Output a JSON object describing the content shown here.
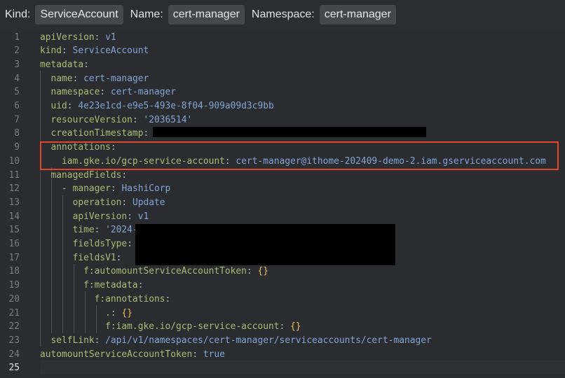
{
  "header": {
    "kind_label": "Kind:",
    "kind_value": "ServiceAccount",
    "name_label": "Name:",
    "name_value": "cert-manager",
    "namespace_label": "Namespace:",
    "namespace_value": "cert-manager"
  },
  "colors": {
    "background": "#2b2c30",
    "key": "#a9bd76",
    "value": "#82a5d8",
    "brace": "#e2c15a",
    "highlight_box": "#e0452f"
  },
  "lines": [
    {
      "n": "1",
      "parts": [
        {
          "t": "apiVersion",
          "c": "k"
        },
        {
          "t": ": ",
          "c": "p"
        },
        {
          "t": "v1",
          "c": "v"
        }
      ]
    },
    {
      "n": "2",
      "parts": [
        {
          "t": "kind",
          "c": "k"
        },
        {
          "t": ": ",
          "c": "p"
        },
        {
          "t": "ServiceAccount",
          "c": "v"
        }
      ]
    },
    {
      "n": "3",
      "parts": [
        {
          "t": "metadata",
          "c": "k"
        },
        {
          "t": ":",
          "c": "p"
        }
      ]
    },
    {
      "n": "4",
      "parts": [
        {
          "t": "  name",
          "c": "k"
        },
        {
          "t": ": ",
          "c": "p"
        },
        {
          "t": "cert-manager",
          "c": "v"
        }
      ]
    },
    {
      "n": "5",
      "parts": [
        {
          "t": "  namespace",
          "c": "k"
        },
        {
          "t": ": ",
          "c": "p"
        },
        {
          "t": "cert-manager",
          "c": "v"
        }
      ]
    },
    {
      "n": "6",
      "parts": [
        {
          "t": "  uid",
          "c": "k"
        },
        {
          "t": ": ",
          "c": "p"
        },
        {
          "t": "4e23e1cd-e9e5-493e-8f04-909a09d3c9bb",
          "c": "v"
        }
      ]
    },
    {
      "n": "7",
      "parts": [
        {
          "t": "  resourceVersion",
          "c": "k"
        },
        {
          "t": ": ",
          "c": "p"
        },
        {
          "t": "'2036514'",
          "c": "v"
        }
      ]
    },
    {
      "n": "8",
      "parts": [
        {
          "t": "  creationTimestamp",
          "c": "k"
        },
        {
          "t": ":",
          "c": "p"
        }
      ]
    },
    {
      "n": "9",
      "parts": [
        {
          "t": "  annotations",
          "c": "k"
        },
        {
          "t": ":",
          "c": "p"
        }
      ]
    },
    {
      "n": "10",
      "parts": [
        {
          "t": "    iam.gke.io/gcp-service-account",
          "c": "k"
        },
        {
          "t": ": ",
          "c": "p"
        },
        {
          "t": "cert-manager@ithome-202409-demo-2.iam.gserviceaccount.com",
          "c": "v"
        }
      ]
    },
    {
      "n": "11",
      "parts": [
        {
          "t": "  managedFields",
          "c": "k"
        },
        {
          "t": ":",
          "c": "p"
        }
      ]
    },
    {
      "n": "12",
      "parts": [
        {
          "t": "    - ",
          "c": "p"
        },
        {
          "t": "manager",
          "c": "k"
        },
        {
          "t": ": ",
          "c": "p"
        },
        {
          "t": "HashiCorp",
          "c": "v"
        }
      ]
    },
    {
      "n": "13",
      "parts": [
        {
          "t": "      operation",
          "c": "k"
        },
        {
          "t": ": ",
          "c": "p"
        },
        {
          "t": "Update",
          "c": "v"
        }
      ]
    },
    {
      "n": "14",
      "parts": [
        {
          "t": "      apiVersion",
          "c": "k"
        },
        {
          "t": ": ",
          "c": "p"
        },
        {
          "t": "v1",
          "c": "v"
        }
      ]
    },
    {
      "n": "15",
      "parts": [
        {
          "t": "      time",
          "c": "k"
        },
        {
          "t": ": ",
          "c": "p"
        },
        {
          "t": "'2024-",
          "c": "v"
        }
      ]
    },
    {
      "n": "16",
      "parts": [
        {
          "t": "      fieldsType",
          "c": "k"
        },
        {
          "t": ":",
          "c": "p"
        }
      ]
    },
    {
      "n": "17",
      "parts": [
        {
          "t": "      fieldsV1",
          "c": "k"
        },
        {
          "t": ":",
          "c": "p"
        }
      ]
    },
    {
      "n": "18",
      "parts": [
        {
          "t": "        f:automountServiceAccountToken",
          "c": "k"
        },
        {
          "t": ": ",
          "c": "p"
        },
        {
          "t": "{}",
          "c": "br"
        }
      ]
    },
    {
      "n": "19",
      "parts": [
        {
          "t": "        f:metadata",
          "c": "k"
        },
        {
          "t": ":",
          "c": "p"
        }
      ]
    },
    {
      "n": "20",
      "parts": [
        {
          "t": "          f:annotations",
          "c": "k"
        },
        {
          "t": ":",
          "c": "p"
        }
      ]
    },
    {
      "n": "21",
      "parts": [
        {
          "t": "            .",
          "c": "k"
        },
        {
          "t": ": ",
          "c": "p"
        },
        {
          "t": "{}",
          "c": "br"
        }
      ]
    },
    {
      "n": "22",
      "parts": [
        {
          "t": "            f:iam.gke.io/gcp-service-account",
          "c": "k"
        },
        {
          "t": ": ",
          "c": "p"
        },
        {
          "t": "{}",
          "c": "br"
        }
      ]
    },
    {
      "n": "23",
      "parts": [
        {
          "t": "  selfLink",
          "c": "k"
        },
        {
          "t": ": ",
          "c": "p"
        },
        {
          "t": "/api/v1/namespaces/cert-manager/serviceaccounts/cert-manager",
          "c": "v"
        }
      ]
    },
    {
      "n": "24",
      "parts": [
        {
          "t": "automountServiceAccountToken",
          "c": "k"
        },
        {
          "t": ": ",
          "c": "p"
        },
        {
          "t": "true",
          "c": "v"
        }
      ]
    },
    {
      "n": "25",
      "parts": []
    }
  ]
}
